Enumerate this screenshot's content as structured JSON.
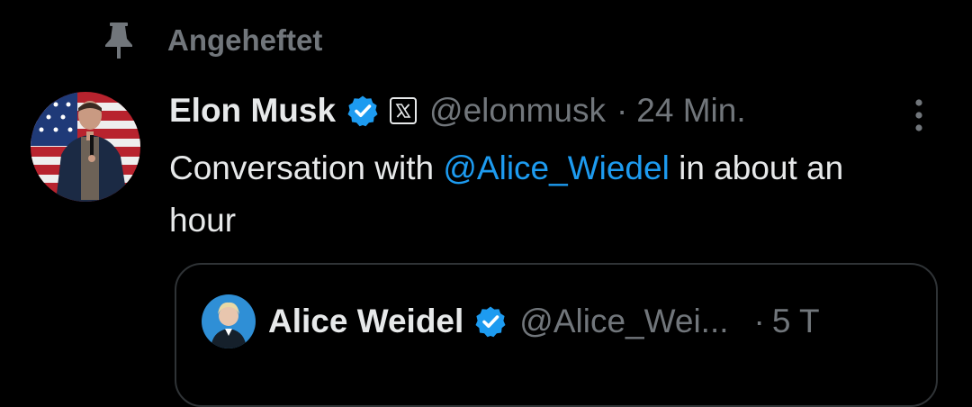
{
  "pinned": {
    "label": "Angeheftet",
    "icon": "pin-icon"
  },
  "tweet": {
    "author_name": "Elon Musk",
    "verified_icon": "verified-badge-icon",
    "affiliation_icon": "x-logo-icon",
    "handle": "@elonmusk",
    "separator": "·",
    "timestamp": "24 Min.",
    "text_before": "Conversation with ",
    "mention": "@Alice_Wiedel",
    "text_after": " in about an hour",
    "more_icon": "more-vertical-icon"
  },
  "quote": {
    "author_name": "Alice Weidel",
    "verified_icon": "verified-badge-icon",
    "handle": "@Alice_Wei...",
    "separator": "·",
    "timestamp": "5 T"
  },
  "colors": {
    "background": "#000000",
    "text_primary": "#e7e9ea",
    "text_secondary": "#71767b",
    "link": "#1d9bf0",
    "verified": "#1d9bf0",
    "card_border": "#2f3336"
  }
}
